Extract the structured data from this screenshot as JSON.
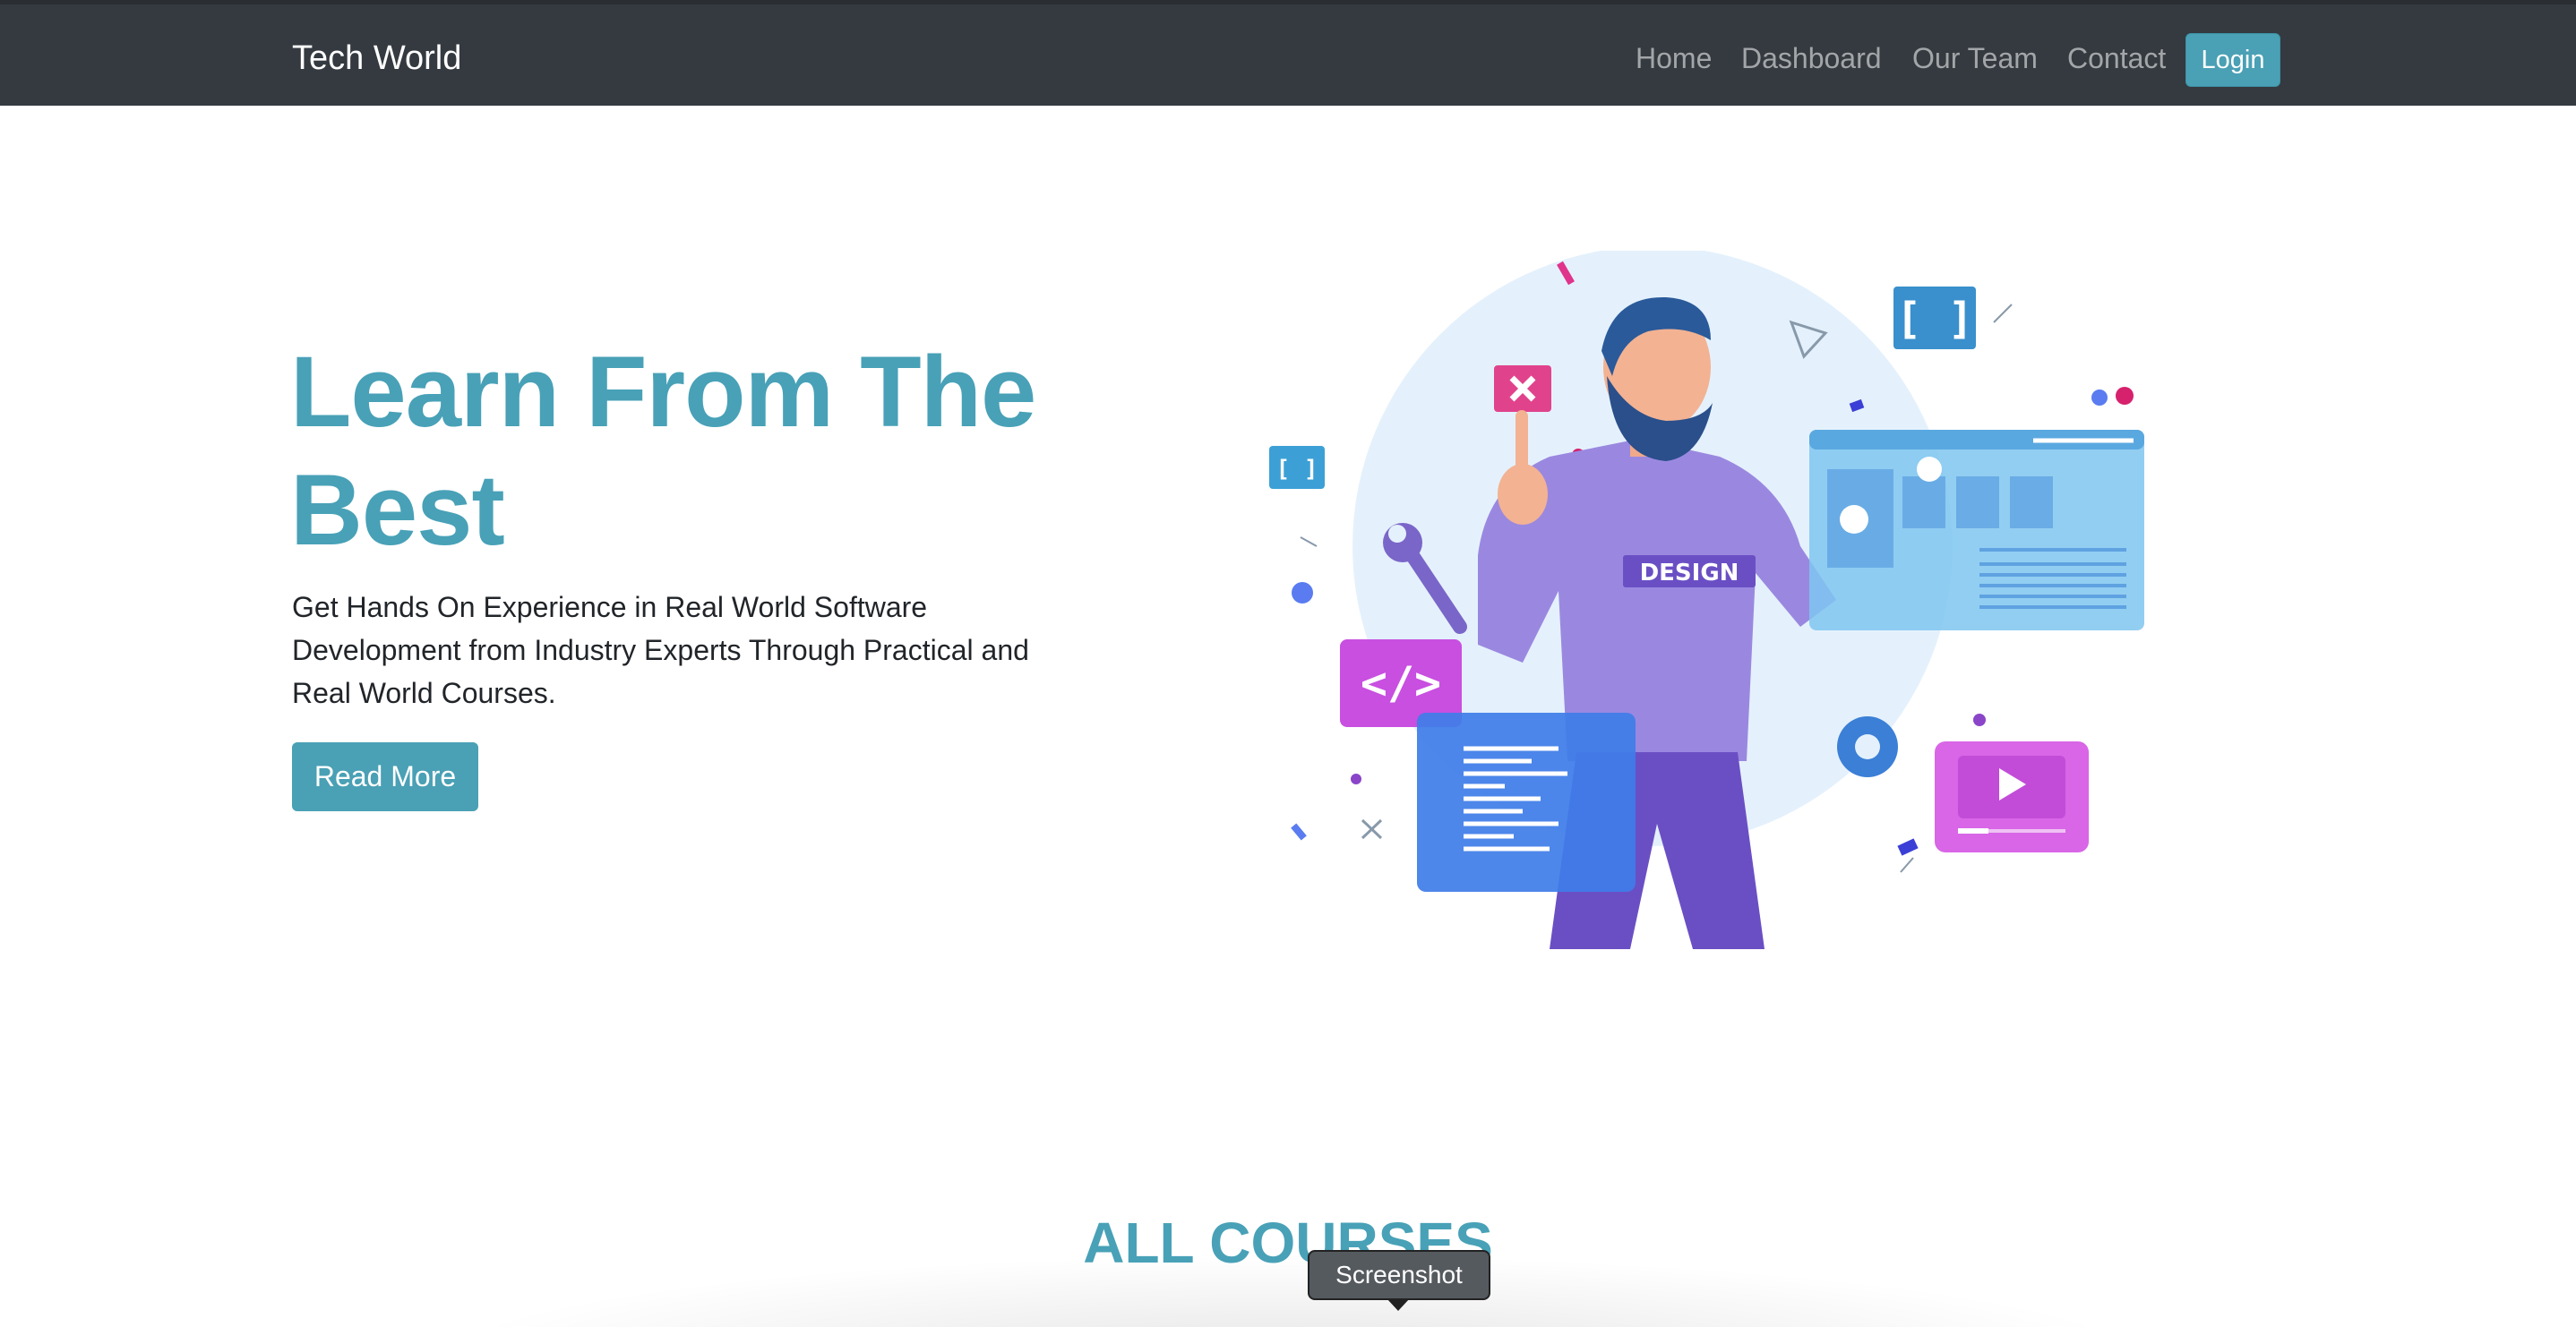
{
  "navbar": {
    "brand": "Tech World",
    "links": [
      "Home",
      "Dashboard",
      "Our Team",
      "Contact"
    ],
    "login": "Login"
  },
  "hero": {
    "title_line1": "Learn From The",
    "title_line2": "Best",
    "subtitle_line1": "Get Hands On Experience in Real World Software",
    "subtitle_line2": "Development from Industry Experts Through Practical and",
    "subtitle_line3": "Real World Courses.",
    "button": "Read More",
    "illustration": {
      "shirt_text": "DESIGN",
      "code_tag": "</>",
      "bracket_small": "[ ]",
      "bracket_large": "[ ]"
    }
  },
  "courses": {
    "title": "ALL COURSES"
  },
  "tooltip": "Screenshot",
  "colors": {
    "accent": "#48a1b7",
    "navbar_bg": "#343a40",
    "button_bg": "#4aa0b5"
  }
}
